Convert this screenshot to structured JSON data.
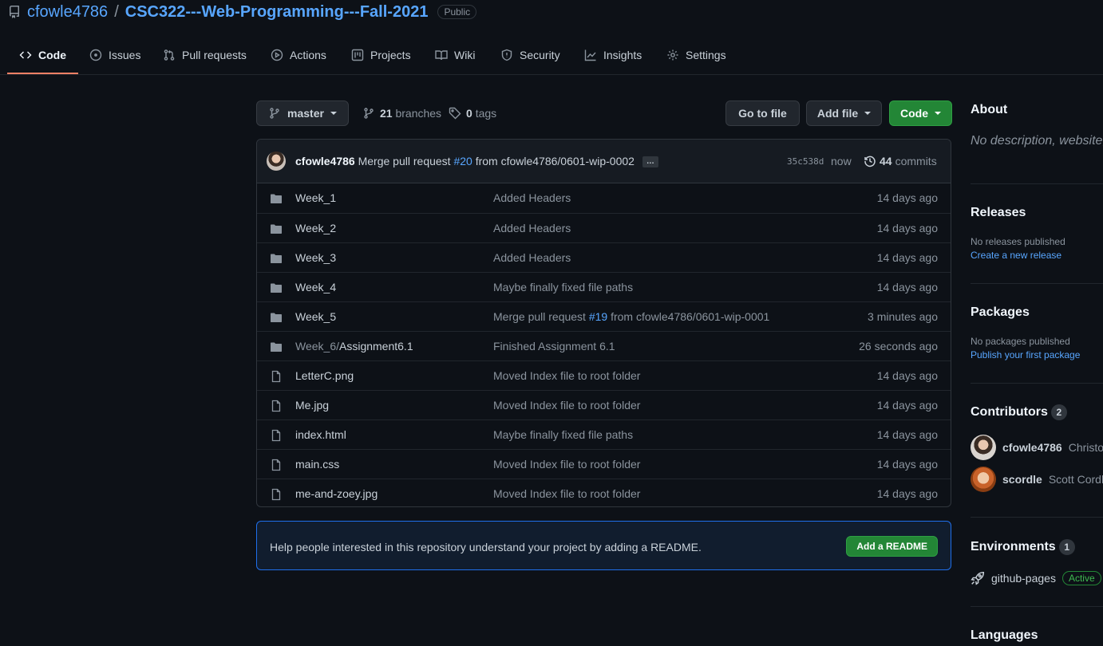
{
  "repo": {
    "owner": "cfowle4786",
    "separator": "/",
    "name": "CSC322---Web-Programming---Fall-2021",
    "visibility": "Public"
  },
  "tabs": [
    {
      "label": "Code",
      "icon": "code-icon",
      "active": true
    },
    {
      "label": "Issues",
      "icon": "issue-icon"
    },
    {
      "label": "Pull requests",
      "icon": "pull-request-icon"
    },
    {
      "label": "Actions",
      "icon": "play-icon"
    },
    {
      "label": "Projects",
      "icon": "project-icon"
    },
    {
      "label": "Wiki",
      "icon": "book-icon"
    },
    {
      "label": "Security",
      "icon": "shield-icon"
    },
    {
      "label": "Insights",
      "icon": "graph-icon"
    },
    {
      "label": "Settings",
      "icon": "gear-icon"
    }
  ],
  "toolbar": {
    "branch": "master",
    "branches_count": "21",
    "branches_label": "branches",
    "tags_count": "0",
    "tags_label": "tags",
    "go_to_file": "Go to file",
    "add_file": "Add file",
    "code": "Code"
  },
  "commit": {
    "author": "cfowle4786",
    "msg_prefix": "Merge pull request",
    "pr": "#20",
    "msg_suffix": "from cfowle4786/0601-wip-0002",
    "ellipsis": "…",
    "sha": "35c538d",
    "when": "now",
    "commits_count": "44",
    "commits_label": "commits"
  },
  "files": [
    {
      "type": "dir",
      "name": "Week_1",
      "message": "Added Headers",
      "age": "14 days ago"
    },
    {
      "type": "dir",
      "name": "Week_2",
      "message": "Added Headers",
      "age": "14 days ago"
    },
    {
      "type": "dir",
      "name": "Week_3",
      "message": "Added Headers",
      "age": "14 days ago"
    },
    {
      "type": "dir",
      "name": "Week_4",
      "message": "Maybe finally fixed file paths",
      "age": "14 days ago"
    },
    {
      "type": "dir",
      "name": "Week_5",
      "message_prefix": "Merge pull request",
      "message_pr": "#19",
      "message_suffix": "from cfowle4786/0601-wip-0001",
      "age": "3 minutes ago"
    },
    {
      "type": "dir",
      "name_dim": "Week_6/",
      "name": "Assignment6.1",
      "message": "Finished Assignment 6.1",
      "age": "26 seconds ago"
    },
    {
      "type": "file",
      "name": "LetterC.png",
      "message": "Moved Index file to root folder",
      "age": "14 days ago"
    },
    {
      "type": "file",
      "name": "Me.jpg",
      "message": "Moved Index file to root folder",
      "age": "14 days ago"
    },
    {
      "type": "file",
      "name": "index.html",
      "message": "Maybe finally fixed file paths",
      "age": "14 days ago"
    },
    {
      "type": "file",
      "name": "main.css",
      "message": "Moved Index file to root folder",
      "age": "14 days ago"
    },
    {
      "type": "file",
      "name": "me-and-zoey.jpg",
      "message": "Moved Index file to root folder",
      "age": "14 days ago"
    }
  ],
  "readme": {
    "text": "Help people interested in this repository understand your project by adding a README.",
    "button": "Add a README"
  },
  "sidebar": {
    "about_title": "About",
    "about_desc": "No description, website,",
    "releases_title": "Releases",
    "releases_none": "No releases published",
    "releases_link": "Create a new release",
    "packages_title": "Packages",
    "packages_none": "No packages published",
    "packages_link": "Publish your first package",
    "contributors_title": "Contributors",
    "contributors_count": "2",
    "contributors": [
      {
        "login": "cfowle4786",
        "name": "Christop"
      },
      {
        "login": "scordle",
        "name": "Scott Cordle"
      }
    ],
    "environments_title": "Environments",
    "environments_count": "1",
    "environment": {
      "name": "github-pages",
      "status": "Active"
    },
    "languages_title": "Languages"
  },
  "colors": {
    "background": "#0d1117",
    "link": "#58a6ff",
    "green_button": "#238636",
    "tab_underline": "#f78166"
  }
}
